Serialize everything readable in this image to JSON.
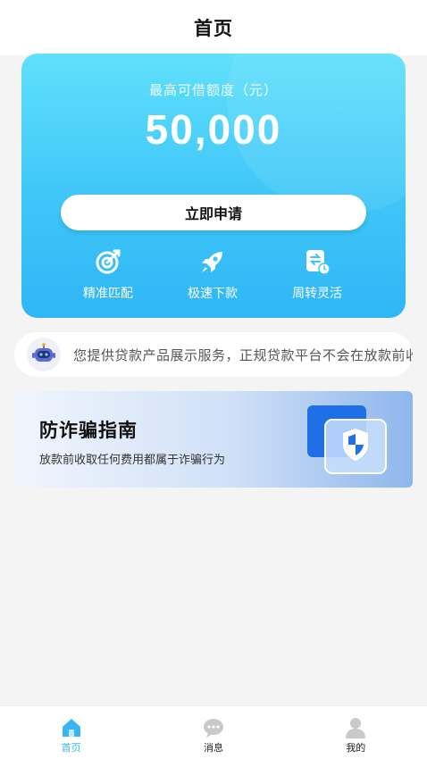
{
  "header": {
    "title": "首页"
  },
  "card": {
    "credit_label": "最高可借额度（元）",
    "credit_amount": "50,000",
    "apply_label": "立即申请",
    "features": [
      {
        "label": "精准匹配",
        "icon": "target-icon"
      },
      {
        "label": "极速下款",
        "icon": "rocket-icon"
      },
      {
        "label": "周转灵活",
        "icon": "transfer-clock-icon"
      }
    ]
  },
  "notice": {
    "icon": "robot-icon",
    "text": "您提供贷款产品展示服务，正规贷款平台不会在放款前收取任何费用"
  },
  "fraud_guide": {
    "title": "防诈骗指南",
    "subtitle": "放款前收取任何费用都属于诈骗行为",
    "icon": "shield-icon"
  },
  "tabbar": {
    "items": [
      {
        "label": "首页",
        "icon": "home-icon",
        "active": true
      },
      {
        "label": "消息",
        "icon": "message-icon",
        "active": false
      },
      {
        "label": "我的",
        "icon": "user-icon",
        "active": false
      }
    ]
  },
  "colors": {
    "accent": "#36b7f1",
    "card_top": "#5fe0fb",
    "card_bottom": "#2fb6f6"
  }
}
